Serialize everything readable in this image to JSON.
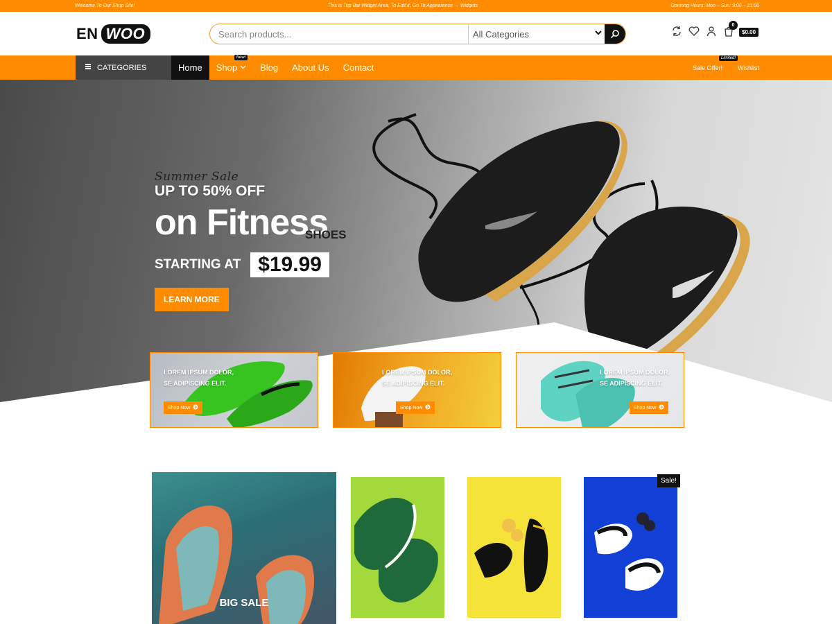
{
  "topbar": {
    "left": "Welcome To Our Shop Site!",
    "center": "This Is Top Bar Widget Area, To Edit It, Go To Appearence → Widgets",
    "right": "Opening Hours: Mon – Sun: 9:00 – 21:00"
  },
  "header": {
    "logo_left": "EN",
    "logo_right": "WOO",
    "search_placeholder": "Search products...",
    "category_select": "All Categories",
    "cart_count": "0",
    "cart_total": "$0.00"
  },
  "nav": {
    "categories": "CATEGORIES",
    "links": [
      "Home",
      "Shop",
      "Blog",
      "About Us",
      "Contact"
    ],
    "shop_tag": "New!",
    "right": [
      "Sale Offer!",
      "Wishlist"
    ],
    "right_tag": "Limited!"
  },
  "hero": {
    "script": "Summer Sale",
    "upto": "UP TO 50% OFF",
    "headline": "on Fitness",
    "sub": "SHOES",
    "starting": "STARTING AT",
    "price": "$19.99",
    "cta": "LEARN MORE"
  },
  "promos": [
    {
      "line1": "LOREM IPSUM DOLOR,",
      "line2": "SE ADIPISCING ELIT.",
      "button": "Shop Now"
    },
    {
      "line1": "LOREM IPSUM DOLOR,",
      "line2": "SE ADIPISCING ELIT.",
      "button": "Shop Now"
    },
    {
      "line1": "LOREM IPSUM DOLOR,",
      "line2": "SE ADIPISCING ELIT.",
      "button": "Shop Now"
    }
  ],
  "products": {
    "big_sale": "BIG SALE",
    "sale_badge": "Sale!"
  },
  "colors": {
    "accent": "#ff8c00",
    "dark": "#111111"
  }
}
